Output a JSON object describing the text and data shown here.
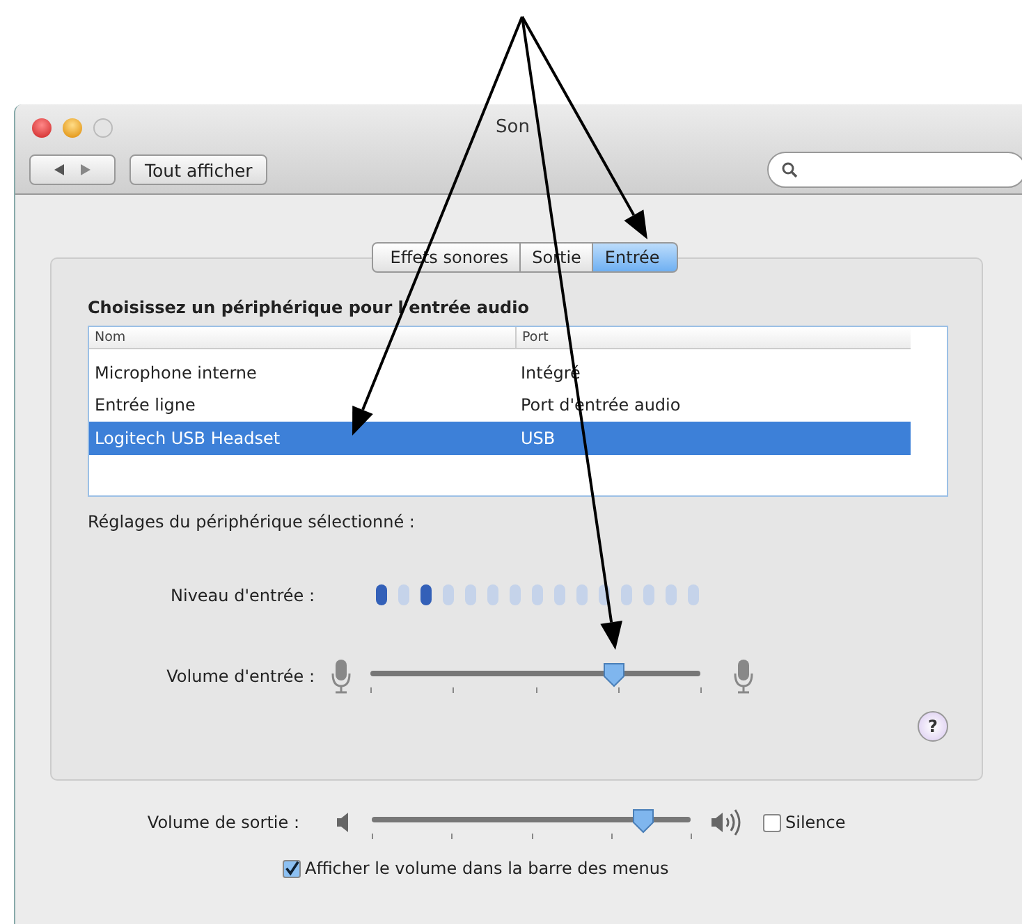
{
  "window": {
    "title": "Son"
  },
  "toolbar": {
    "show_all_button": "Tout afficher"
  },
  "tabs": [
    {
      "label": "Effets sonores",
      "selected": false
    },
    {
      "label": "Sortie",
      "selected": false
    },
    {
      "label": "Entrée",
      "selected": true
    }
  ],
  "device_heading": "Choisissez un périphérique pour l'entrée audio",
  "table": {
    "columns": [
      "Nom",
      "Port"
    ],
    "rows": [
      {
        "name": "Microphone interne",
        "port": "Intégré",
        "selected": false
      },
      {
        "name": "Entrée ligne",
        "port": "Port d'entrée audio",
        "selected": false
      },
      {
        "name": "Logitech USB Headset",
        "port": "USB",
        "selected": true
      }
    ]
  },
  "settings_heading": "Réglages du périphérique sélectionné :",
  "input_level": {
    "label": "Niveau d'entrée :",
    "segments": [
      {
        "lit": true
      },
      {
        "lit": false
      },
      {
        "lit": true
      },
      {
        "lit": false
      },
      {
        "lit": false
      },
      {
        "lit": false
      },
      {
        "lit": false
      },
      {
        "lit": false
      },
      {
        "lit": false
      },
      {
        "lit": false
      },
      {
        "lit": false
      },
      {
        "lit": false
      },
      {
        "lit": false
      },
      {
        "lit": false
      },
      {
        "lit": false
      }
    ]
  },
  "input_volume": {
    "label": "Volume d'entrée :",
    "level": 0.74
  },
  "help_button": "?",
  "output_volume": {
    "label": "Volume de sortie :",
    "level": 0.85
  },
  "mute": {
    "label": "Silence",
    "checked": false
  },
  "menu_bar_volume": {
    "label": "Afficher le volume dans la barre des menus",
    "checked": true
  }
}
